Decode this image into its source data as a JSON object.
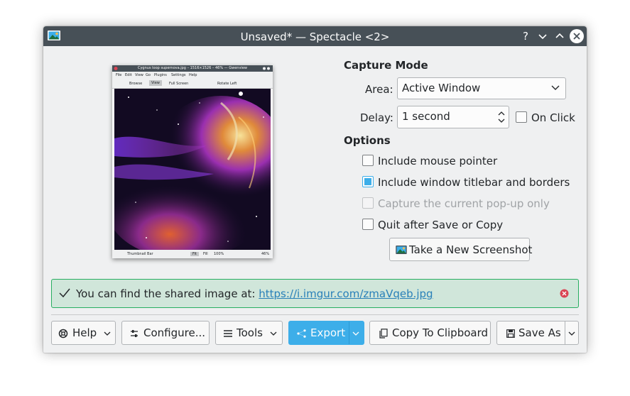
{
  "window": {
    "title": "Unsaved* — Spectacle <2>",
    "buttons": [
      "help-icon",
      "minimize-icon",
      "maximize-icon",
      "close-icon"
    ]
  },
  "preview": {
    "title": "Cygnus loop supernova.jpg – 1516×1526 – 46% — Gwenview",
    "menu": [
      "File",
      "Edit",
      "View",
      "Go",
      "Plugins",
      "Settings",
      "Help"
    ],
    "toolbar": [
      "Browse",
      "View",
      "Full Screen",
      "Rotate Left"
    ],
    "status": [
      "Thumbnail Bar",
      "Fit",
      "Fill",
      "100%",
      "46%"
    ]
  },
  "capture_mode": {
    "heading": "Capture Mode",
    "area_label": "Area:",
    "area_value": "Active Window",
    "delay_label": "Delay:",
    "delay_value": "1 second",
    "on_click_label": "On Click",
    "on_click_checked": false
  },
  "options": {
    "heading": "Options",
    "items": [
      {
        "label": "Include mouse pointer",
        "checked": false,
        "enabled": true
      },
      {
        "label": "Include window titlebar and borders",
        "checked": true,
        "enabled": true
      },
      {
        "label": "Capture the current pop-up only",
        "checked": false,
        "enabled": false
      },
      {
        "label": "Quit after Save or Copy",
        "checked": false,
        "enabled": true
      }
    ]
  },
  "take_screenshot_label": "Take a New Screenshot",
  "notice": {
    "message": "You can find the shared image at: ",
    "link": "https://i.imgur.com/zmaVqeb.jpg"
  },
  "bottom_buttons": {
    "help": "Help",
    "configure": "Configure...",
    "tools": "Tools",
    "export": "Export",
    "copy": "Copy To Clipboard",
    "save_as": "Save As"
  },
  "colors": {
    "accent": "#3daee9",
    "titlebar": "#475057",
    "notice_bg": "#d0e6da",
    "notice_border": "#27ae60",
    "close_red": "#da4453"
  }
}
